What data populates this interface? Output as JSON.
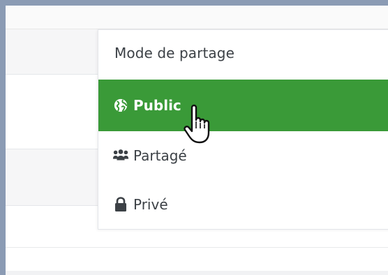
{
  "share_menu": {
    "header": "Mode de partage",
    "items": [
      {
        "label": "Public",
        "icon": "globe-icon",
        "selected": true
      },
      {
        "label": "Partagé",
        "icon": "users-icon",
        "selected": false
      },
      {
        "label": "Privé",
        "icon": "lock-icon",
        "selected": false
      }
    ]
  },
  "colors": {
    "selected_background": "#3a9a38",
    "selected_text": "#ffffff",
    "text": "#3c4146",
    "frame": "#8b9bb4"
  }
}
